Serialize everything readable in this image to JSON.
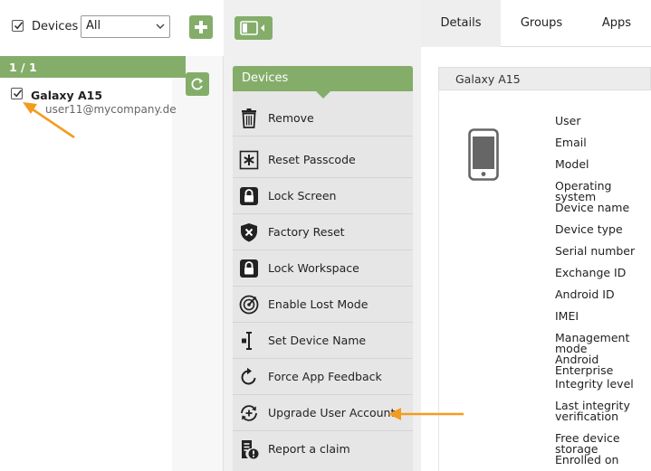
{
  "filter": {
    "label": "Devices",
    "selected": "All"
  },
  "list": {
    "count": "1 / 1",
    "items": [
      {
        "name": "Galaxy A15",
        "email": "user11@mycompany.de"
      }
    ]
  },
  "menu": {
    "header": "Devices",
    "items": [
      {
        "label": "Remove",
        "icon": "trash-icon"
      },
      {
        "label": "Reset Passcode",
        "icon": "asterisk-icon"
      },
      {
        "label": "Lock Screen",
        "icon": "lock-icon"
      },
      {
        "label": "Factory Reset",
        "icon": "shield-x-icon"
      },
      {
        "label": "Lock Workspace",
        "icon": "lock-icon"
      },
      {
        "label": "Enable Lost Mode",
        "icon": "radar-icon"
      },
      {
        "label": "Set Device Name",
        "icon": "text-cursor-icon"
      },
      {
        "label": "Force App Feedback",
        "icon": "refresh-arrow-icon"
      },
      {
        "label": "Upgrade User Account",
        "icon": "upgrade-account-icon"
      },
      {
        "label": "Report a claim",
        "icon": "report-claim-icon"
      }
    ]
  },
  "tabs": [
    "Details",
    "Groups",
    "Apps"
  ],
  "details": {
    "title": "Galaxy A15",
    "fields": [
      "User",
      "Email",
      "Model",
      "Operating system",
      "Device name",
      "Device type",
      "Serial number",
      "Exchange ID",
      "Android ID",
      "IMEI",
      "Management mode",
      "Android Enterprise",
      "Integrity level",
      "Last integrity verification",
      "Free device storage",
      "Enrolled on"
    ]
  },
  "colors": {
    "accent": "#84ad6a",
    "arrow": "#f39c1f"
  }
}
